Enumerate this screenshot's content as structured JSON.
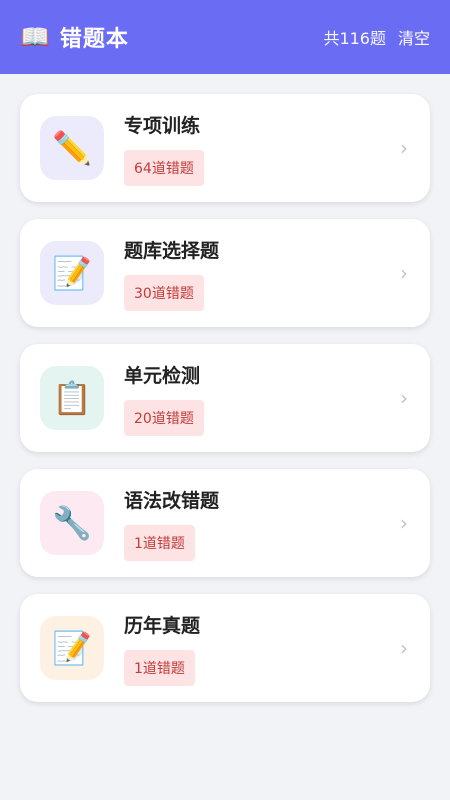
{
  "header": {
    "icon": "open-book-icon",
    "icon_glyph": "📖",
    "title": "错题本",
    "total": "共116题",
    "clear_label": "清空",
    "background": "#6b6cf4"
  },
  "items": [
    {
      "name": "专项训练",
      "badge": "64道错题",
      "icon": "pencil-icon",
      "glyph": "✏️",
      "icon_bg": "#ecebfb"
    },
    {
      "name": "题库选择题",
      "badge": "30道错题",
      "icon": "memo-icon",
      "glyph": "📝",
      "icon_bg": "#ecebfb"
    },
    {
      "name": "单元检测",
      "badge": "20道错题",
      "icon": "clipboard-icon",
      "glyph": "📋",
      "icon_bg": "#e4f5f1"
    },
    {
      "name": "语法改错题",
      "badge": "1道错题",
      "icon": "wrench-icon",
      "glyph": "🔧",
      "icon_bg": "#fce9f1"
    },
    {
      "name": "历年真题",
      "badge": "1道错题",
      "icon": "memo-icon",
      "glyph": "📝",
      "icon_bg": "#fdf1e3"
    }
  ],
  "chevron_glyph": "›",
  "badge_colors": {
    "background": "#fde3e3",
    "text": "#c23b3b"
  }
}
